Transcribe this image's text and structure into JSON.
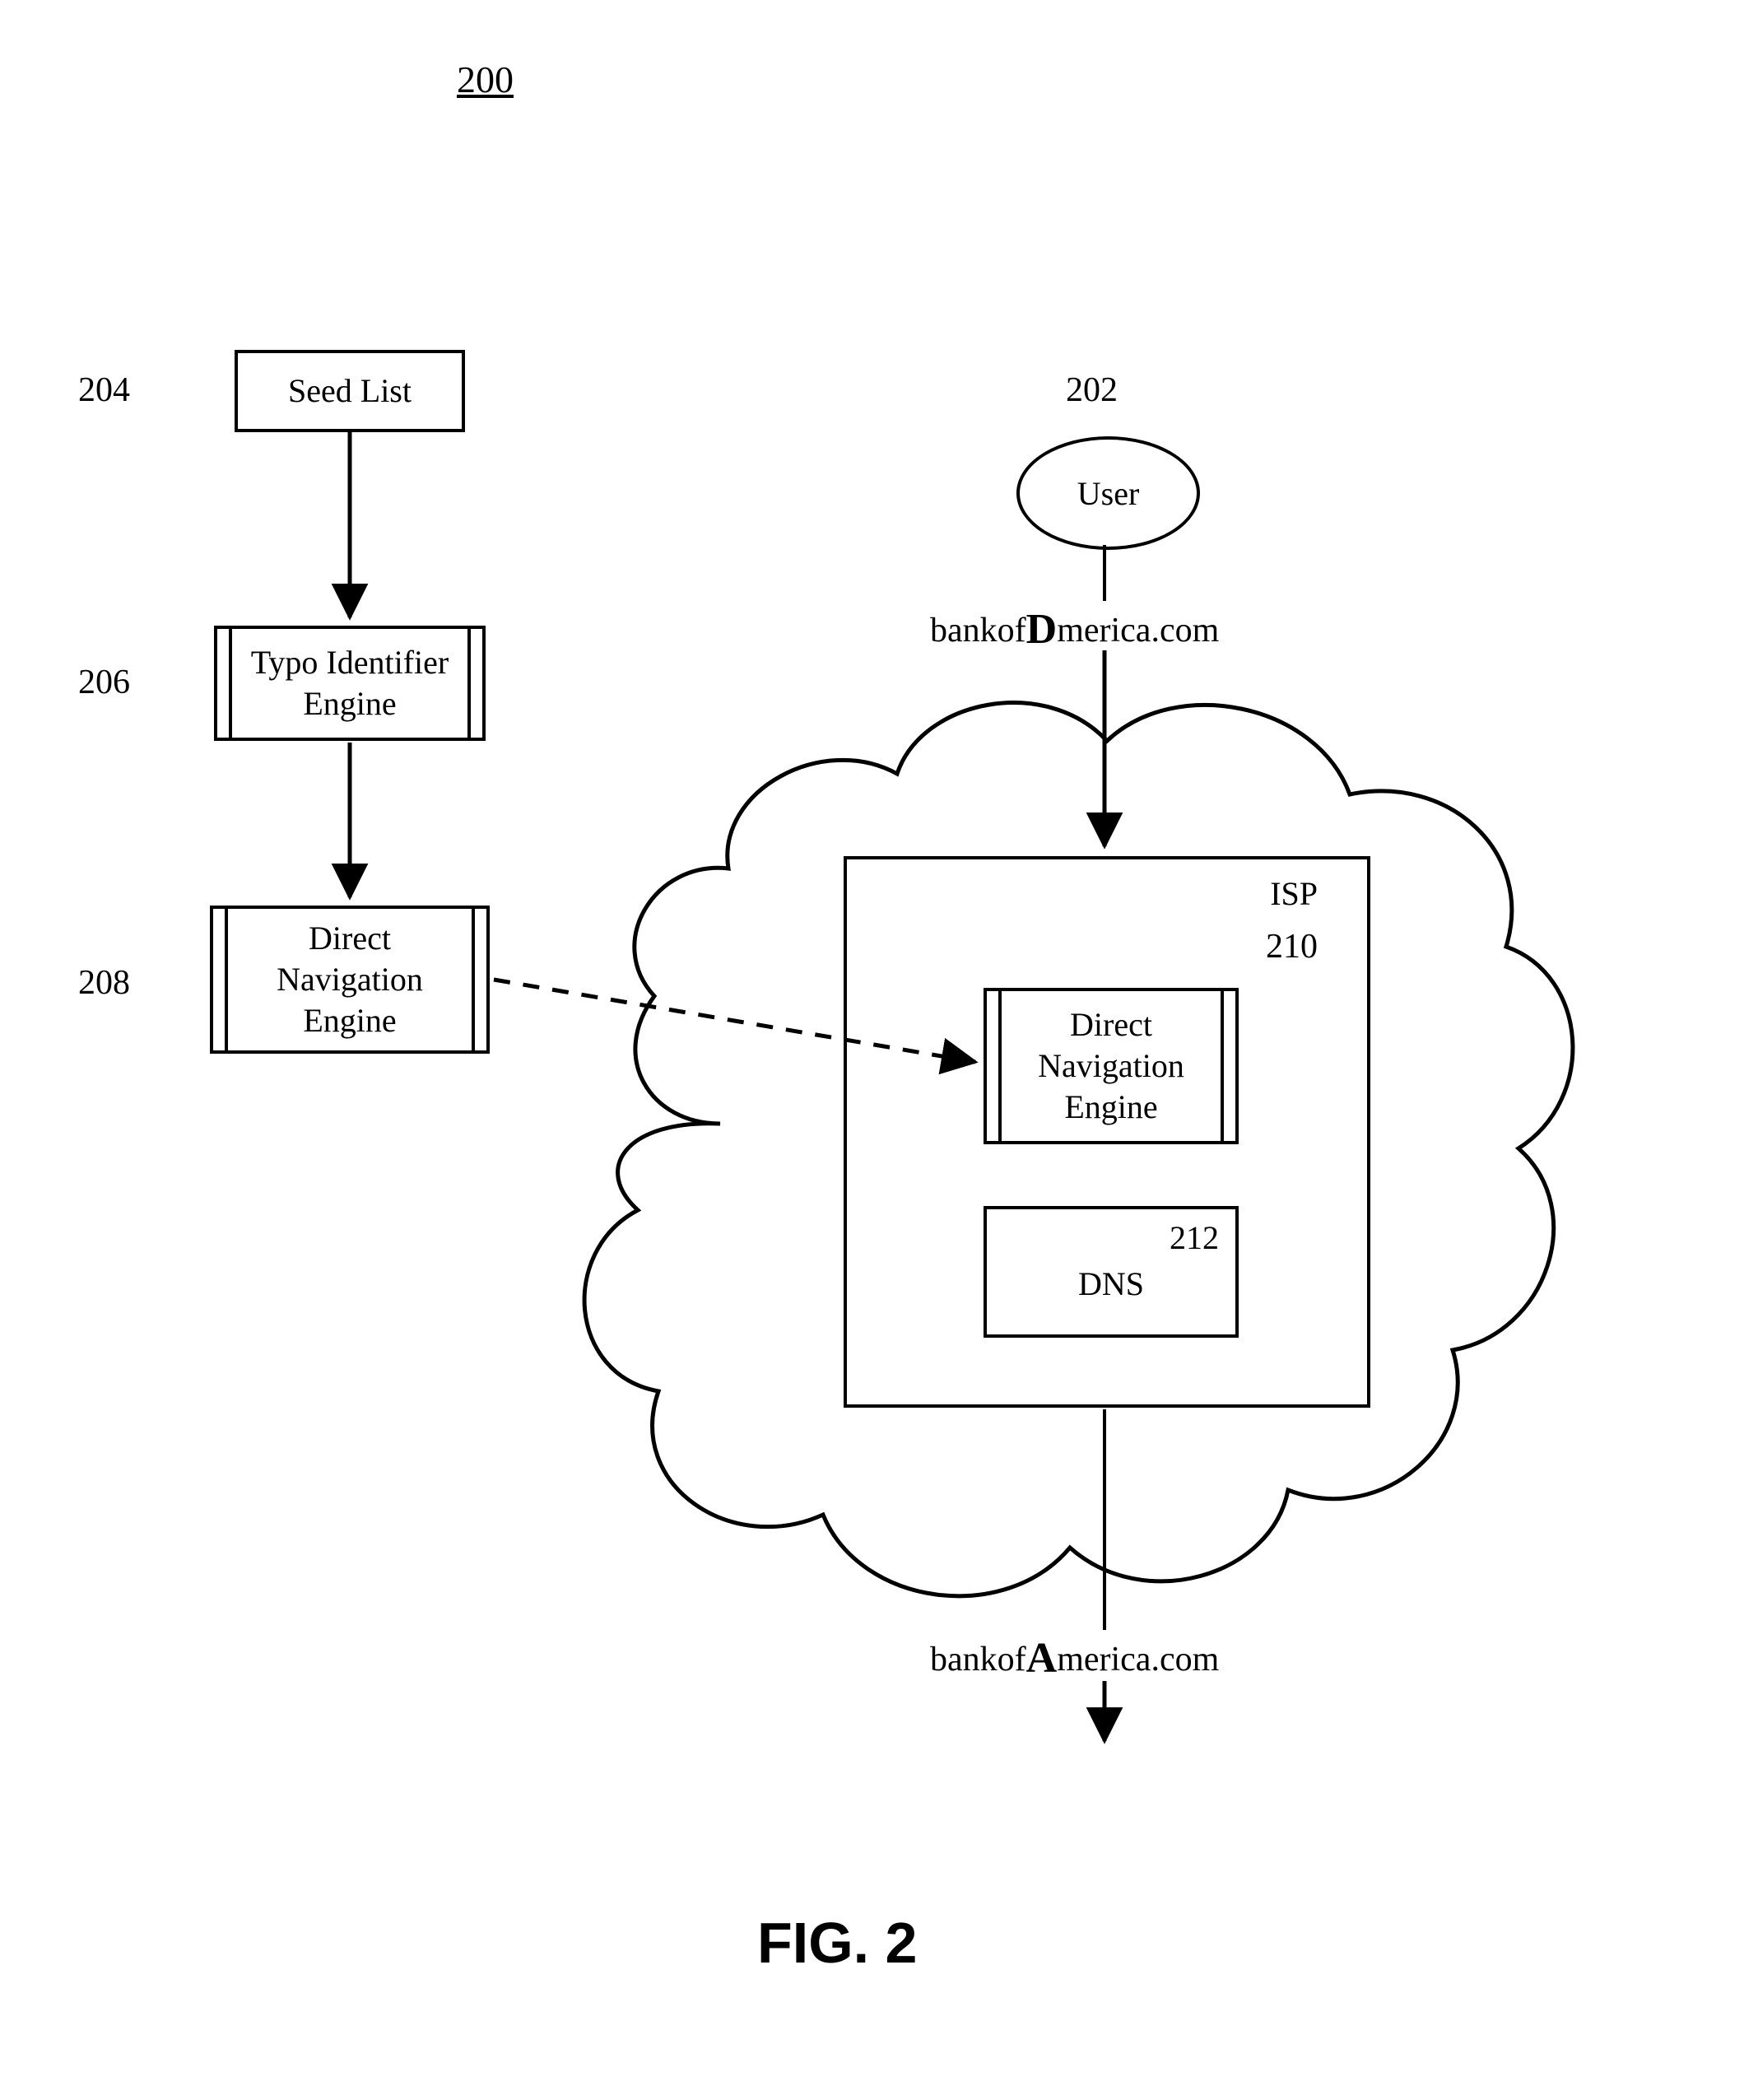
{
  "figure_id": "200",
  "ref_numbers": {
    "seed_list": "204",
    "typo_engine": "206",
    "dn_engine_left": "208",
    "user": "202",
    "isp": "210",
    "dns": "212"
  },
  "boxes": {
    "seed_list": "Seed List",
    "typo_engine": "Typo Identifier\nEngine",
    "dn_engine_left": "Direct\nNavigation\nEngine",
    "dn_engine_right": "Direct\nNavigation\nEngine",
    "isp": "ISP",
    "dns": "DNS",
    "user": "User"
  },
  "urls": {
    "typo_pre": "bankof",
    "typo_em": "D",
    "typo_post": "merica.com",
    "corr_pre": "bankof",
    "corr_em": "A",
    "corr_post": "merica.com"
  },
  "caption": "FIG. 2"
}
